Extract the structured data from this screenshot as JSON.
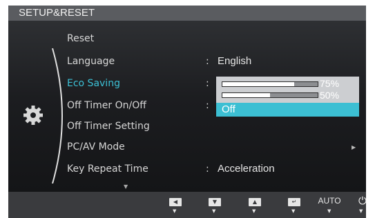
{
  "title": "SETUP&RESET",
  "menu": {
    "items": [
      {
        "label": "Reset",
        "value": "",
        "selected": false
      },
      {
        "label": "Language",
        "value": "English",
        "selected": false
      },
      {
        "label": "Eco Saving",
        "value": "",
        "selected": true
      },
      {
        "label": "Off Timer On/Off",
        "value": "",
        "selected": false
      },
      {
        "label": "Off Timer Setting",
        "value": "",
        "selected": false
      },
      {
        "label": "PC/AV Mode",
        "value": "",
        "selected": false
      },
      {
        "label": "Key Repeat Time",
        "value": "Acceleration",
        "selected": false
      }
    ],
    "separator": ":"
  },
  "eco_dropdown": {
    "options": [
      {
        "label": "75%",
        "level": 0.75
      },
      {
        "label": "50%",
        "level": 0.5
      },
      {
        "label": "Off",
        "highlighted": true
      }
    ]
  },
  "icons": {
    "category": "gear-icon",
    "more_below": "scroll-down-icon",
    "submenu": "chevron-right-icon"
  },
  "buttons": {
    "auto_label": "AUTO",
    "list": [
      "left-button",
      "down-button",
      "up-button",
      "enter-button",
      "auto-button",
      "power-button"
    ]
  },
  "colors": {
    "highlight": "#3cbfd3",
    "selected_text": "#3cc1d6",
    "title_bar": "#5a5c60"
  }
}
